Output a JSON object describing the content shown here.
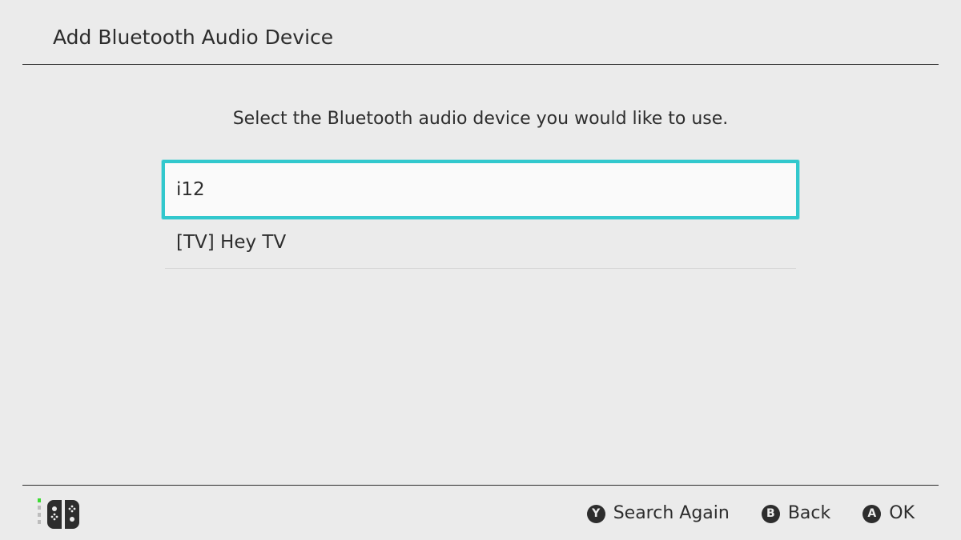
{
  "header": {
    "title": "Add Bluetooth Audio Device"
  },
  "main": {
    "instruction": "Select the Bluetooth audio device you would like to use.",
    "devices": [
      {
        "label": "i12",
        "selected": true
      },
      {
        "label": "[TV] Hey TV",
        "selected": false
      }
    ]
  },
  "footer": {
    "controller_icon": "joycon-pair-icon",
    "actions": [
      {
        "button": "Y",
        "label": "Search Again",
        "icon": "y-button-icon"
      },
      {
        "button": "B",
        "label": "Back",
        "icon": "b-button-icon"
      },
      {
        "button": "A",
        "label": "OK",
        "icon": "a-button-icon"
      }
    ]
  },
  "colors": {
    "background": "#ebebeb",
    "text": "#2d2d2d",
    "selection": "#32c8cd",
    "selected_fill": "#fafafa",
    "indicator": "#3cdc32"
  }
}
